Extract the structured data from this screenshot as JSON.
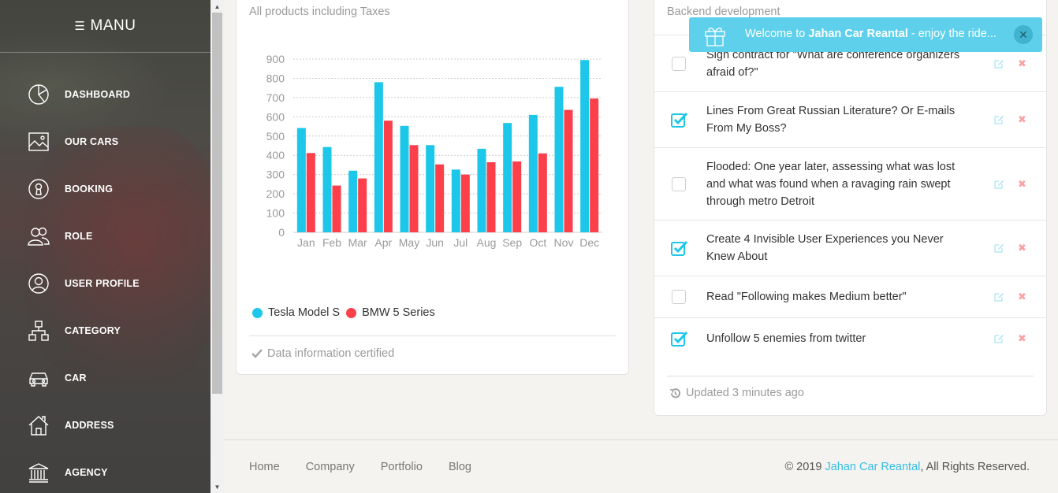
{
  "sidebar": {
    "brand": "MANU",
    "items": [
      {
        "label": "DASHBOARD",
        "icon": "dashboard-icon"
      },
      {
        "label": "OUR CARS",
        "icon": "image-icon"
      },
      {
        "label": "BOOKING",
        "icon": "keyhole-icon"
      },
      {
        "label": "ROLE",
        "icon": "users-icon"
      },
      {
        "label": "USER PROFILE",
        "icon": "user-circle-icon"
      },
      {
        "label": "CATEGORY",
        "icon": "hierarchy-icon"
      },
      {
        "label": "CAR",
        "icon": "car-icon"
      },
      {
        "label": "ADDRESS",
        "icon": "home-icon"
      },
      {
        "label": "AGENCY",
        "icon": "bank-icon"
      }
    ]
  },
  "chart_card": {
    "subtitle": "All products including Taxes",
    "footer": "Data information certified",
    "footer_icon": "check-icon"
  },
  "chart_data": {
    "type": "bar",
    "categories": [
      "Jan",
      "Feb",
      "Mar",
      "Apr",
      "May",
      "Jun",
      "Jul",
      "Aug",
      "Sep",
      "Oct",
      "Nov",
      "Dec"
    ],
    "series": [
      {
        "name": "Tesla Model S",
        "color": "#1dc7ea",
        "values": [
          542,
          443,
          320,
          780,
          553,
          453,
          326,
          434,
          568,
          610,
          756,
          895
        ]
      },
      {
        "name": "BMW 5 Series",
        "color": "#fb404b",
        "values": [
          412,
          243,
          280,
          580,
          453,
          353,
          300,
          364,
          368,
          410,
          636,
          695
        ]
      }
    ],
    "yticks": [
      0,
      100,
      200,
      300,
      400,
      500,
      600,
      700,
      800,
      900
    ],
    "ylim": [
      0,
      900
    ],
    "grid": true,
    "legend_position": "bottom-left"
  },
  "tasks_card": {
    "subtitle": "Backend development",
    "tasks": [
      {
        "text": "Sign contract for \"What are conference organizers afraid of?\"",
        "checked": false
      },
      {
        "text": "Lines From Great Russian Literature? Or E-mails From My Boss?",
        "checked": true
      },
      {
        "text": "Flooded: One year later, assessing what was lost and what was found when a ravaging rain swept through metro Detroit",
        "checked": false
      },
      {
        "text": "Create 4 Invisible User Experiences you Never Knew About",
        "checked": true
      },
      {
        "text": "Read \"Following makes Medium better\"",
        "checked": false
      },
      {
        "text": "Unfollow 5 enemies from twitter",
        "checked": true
      }
    ],
    "delete_glyph": "✖",
    "footer": "Updated 3 minutes ago",
    "footer_icon": "history-icon"
  },
  "notification": {
    "prefix": "Welcome to ",
    "brand": "Jahan Car Reantal",
    "suffix": " - enjoy the ride...",
    "icon": "gift-icon",
    "close_glyph": "✕"
  },
  "footer": {
    "links": [
      "Home",
      "Company",
      "Portfolio",
      "Blog"
    ],
    "copyright_prefix": "© 2019 ",
    "copyright_brand": "Jahan Car Reantal",
    "copyright_suffix": ", All Rights Reserved."
  },
  "colors": {
    "accent": "#1dc7ea",
    "danger": "#fb404b",
    "notification": "#5ed0ec"
  }
}
